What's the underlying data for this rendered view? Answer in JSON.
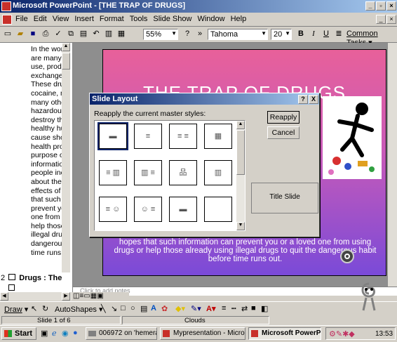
{
  "window": {
    "title": "Microsoft PowerPoint - [THE TRAP OF DRUGS]"
  },
  "menu": [
    "File",
    "Edit",
    "View",
    "Insert",
    "Format",
    "Tools",
    "Slide Show",
    "Window",
    "Help"
  ],
  "toolbar": {
    "zoom": "55%",
    "font": "Tahoma",
    "size": "20",
    "bold": "B",
    "italic": "I",
    "underline": "U",
    "common_tasks": "Common Tasks"
  },
  "outline": {
    "lines": [
      "In the wor",
      "are many |",
      "use, produ",
      "exchange",
      "These dru",
      "cocaine, m",
      "many othe",
      "hazardous",
      "destroy th",
      "healthy hu",
      "cause shor",
      "health prol",
      "purpose of",
      "informatio",
      "people inc",
      "about the",
      "effects of",
      "that such i",
      "prevent yo",
      "one from u",
      "help those",
      "illegal drug",
      "dangerous",
      "time runs"
    ],
    "slide2_number": "2",
    "slide2_title": "Drugs : The"
  },
  "slide": {
    "title": "THE TRAP OF DRUGS",
    "body": "hopes that such information can prevent you or a loved one from using drugs or help those already using illegal drugs to quit the dangerous habit before time runs out."
  },
  "dialog": {
    "title": "Slide Layout",
    "instruction": "Reapply the current master styles:",
    "reapply": "Reapply",
    "cancel": "Cancel",
    "help": "?",
    "close": "X",
    "selected_layout": "Title Slide"
  },
  "notes": {
    "placeholder": "Click to add notes"
  },
  "drawing": {
    "draw": "Draw",
    "autoshapes": "AutoShapes"
  },
  "status": {
    "slide": "Slide 1 of 6",
    "design": "Clouds"
  },
  "taskbar": {
    "start": "Start",
    "tasks": [
      "006972 on 'hemera' (H:)",
      "Mypresentation - Micros...",
      "Microsoft PowerPoin..."
    ],
    "clock": "13:53"
  }
}
